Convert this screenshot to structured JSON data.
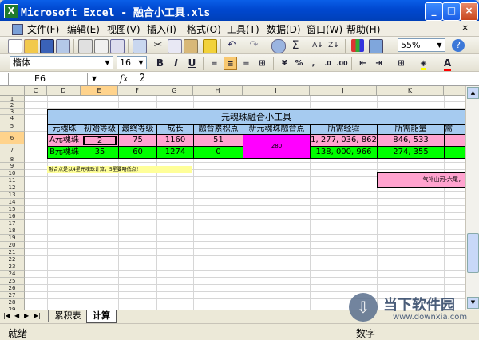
{
  "window": {
    "title": "Microsoft Excel - 融合小工具.xls",
    "app_icon": "X"
  },
  "menu": [
    "文件(F)",
    "编辑(E)",
    "视图(V)",
    "插入(I)",
    "格式(O)",
    "工具(T)",
    "数据(D)",
    "窗口(W)",
    "帮助(H)"
  ],
  "toolbar": {
    "zoom": "55%",
    "font_name": "楷体",
    "font_size": "16"
  },
  "formula": {
    "name_box": "E6",
    "fx": "fx",
    "value": "2"
  },
  "columns": [
    "C",
    "D",
    "E",
    "F",
    "G",
    "H",
    "I",
    "J",
    "K"
  ],
  "rows": [
    "1",
    "2",
    "3",
    "4",
    "5",
    "6",
    "7",
    "8",
    "9",
    "10",
    "11",
    "12",
    "13",
    "14",
    "15",
    "16",
    "17",
    "18",
    "19",
    "20",
    "21",
    "22",
    "23",
    "24",
    "25",
    "26",
    "27",
    "28",
    "29"
  ],
  "table": {
    "title": "元魂珠融合小工具",
    "headers": [
      "元魂珠",
      "初始等级",
      "最终等级",
      "成长",
      "融合累积点",
      "新元魂珠融合点",
      "所需经验",
      "所需能量",
      "需"
    ],
    "row_a": {
      "name": "A元魂珠",
      "init_level": "2",
      "final_level": "75",
      "growth": "1160",
      "points": "51",
      "exp": "1, 277, 036, 862",
      "energy": "846, 533"
    },
    "row_b": {
      "name": "B元魂珠",
      "init_level": "35",
      "final_level": "60",
      "growth": "1274",
      "points": "0",
      "exp": "138, 000, 966",
      "energy": "274, 355"
    },
    "new_points": "280",
    "note": "融合点是以4星元魂珠计算，5星要略低点！",
    "credit": "气补山河-六尾，"
  },
  "sheets": [
    "累积表",
    "计算"
  ],
  "status": {
    "ready": "就绪",
    "num": "数字"
  },
  "watermark": {
    "name": "当下软件园",
    "url": "www.downxia.com"
  },
  "colors": {
    "header_blue": "#a6cbf0",
    "row_a": "#ffa3cf",
    "row_b": "#00ff00",
    "magenta": "#ff00ff",
    "note_yellow": "#ffff99"
  }
}
